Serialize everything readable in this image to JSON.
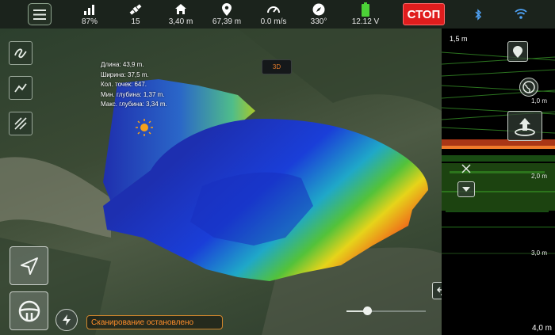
{
  "topbar": {
    "signal": "87%",
    "satellites": "15",
    "home_distance": "3,40 m",
    "location_distance": "67,39 m",
    "speed": "0.0 m/s",
    "heading": "330°",
    "battery_voltage": "12.12 V",
    "stop_label": "СТОП"
  },
  "info": {
    "length": "Длина: 43,9 m.",
    "width": "Ширина: 37,5 m.",
    "points": "Кол. точек: 647.",
    "min_depth": "Мин. глубина: 1,37 m.",
    "max_depth": "Макс. глубина: 3,34 m."
  },
  "view_mode": "3D",
  "status_text": "Сканирование остановлено",
  "sonar": {
    "depth_top": "1,5 m",
    "depth_1": "1,0 m",
    "depth_2": "2,0 m",
    "depth_3": "3,0 m",
    "depth_bottom": "4,0 m"
  },
  "colors": {
    "accent_orange": "#ff8e2b",
    "stop_red": "#e01d1d",
    "battery_green": "#4cd137",
    "wifi_blue": "#4fa3f7"
  }
}
